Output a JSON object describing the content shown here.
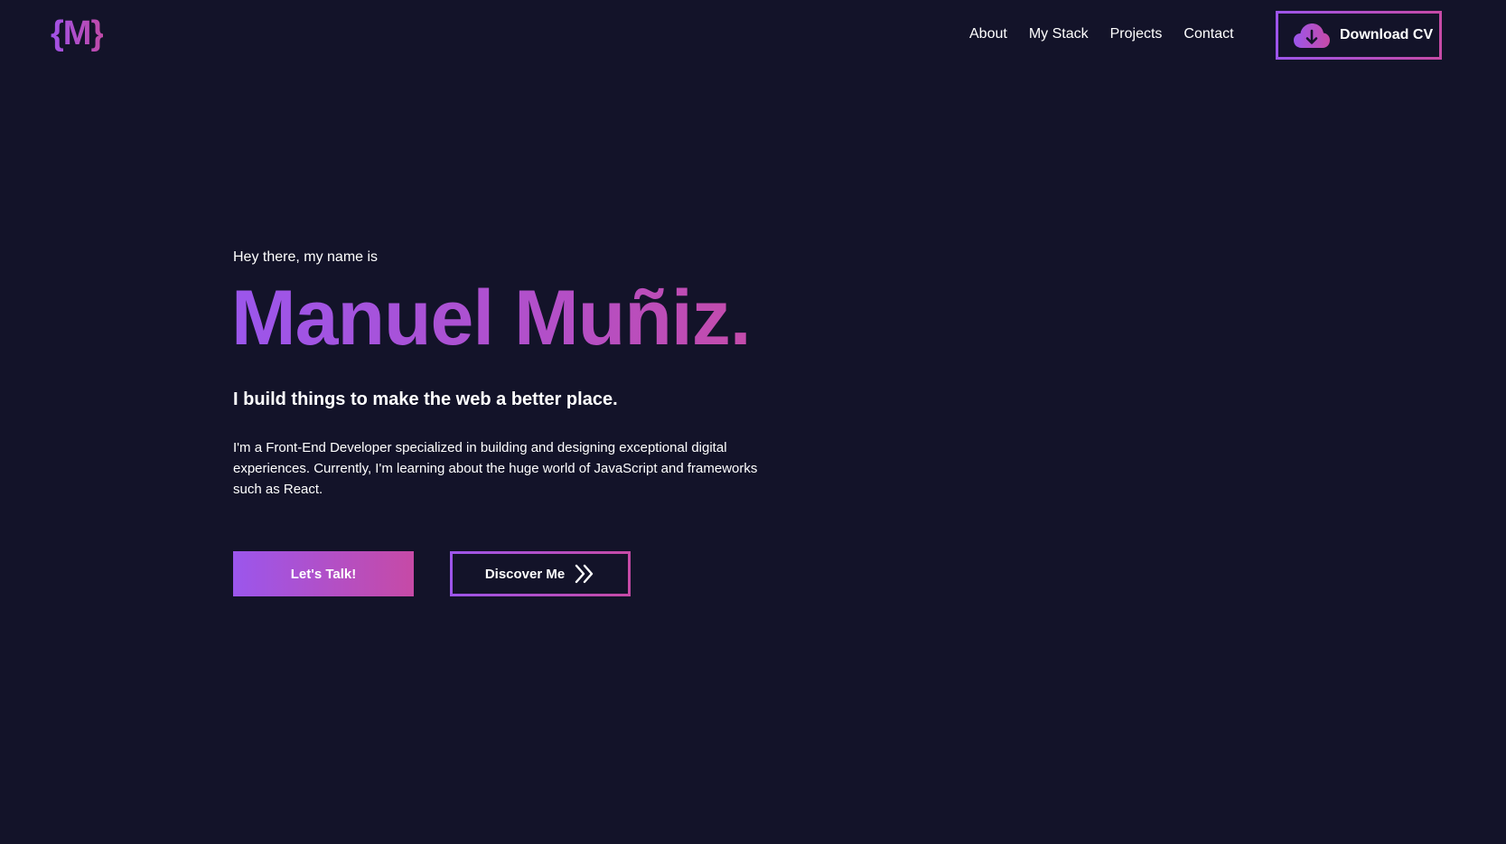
{
  "header": {
    "logo": "{M}",
    "nav": [
      "About",
      "My Stack",
      "Projects",
      "Contact"
    ],
    "cv_button": {
      "label": "Download CV",
      "icon": "cloud-download-icon"
    }
  },
  "hero": {
    "greeting": "Hey there, my name is",
    "name": "Manuel Muñiz.",
    "tagline": "I build things to make the web a better place.",
    "bio": "I'm a Front-End Developer specialized in building and designing exceptional digital experiences. Currently, I'm learning about the huge world of JavaScript and frameworks such as React.",
    "primary_button": "Let's Talk!",
    "secondary_button": {
      "label": "Discover Me",
      "icon": "double-chevron-right-icon"
    }
  },
  "colors": {
    "background": "#131329",
    "accent_start": "#9b56ec",
    "accent_end": "#c64aa6",
    "text": "#ffffff"
  }
}
